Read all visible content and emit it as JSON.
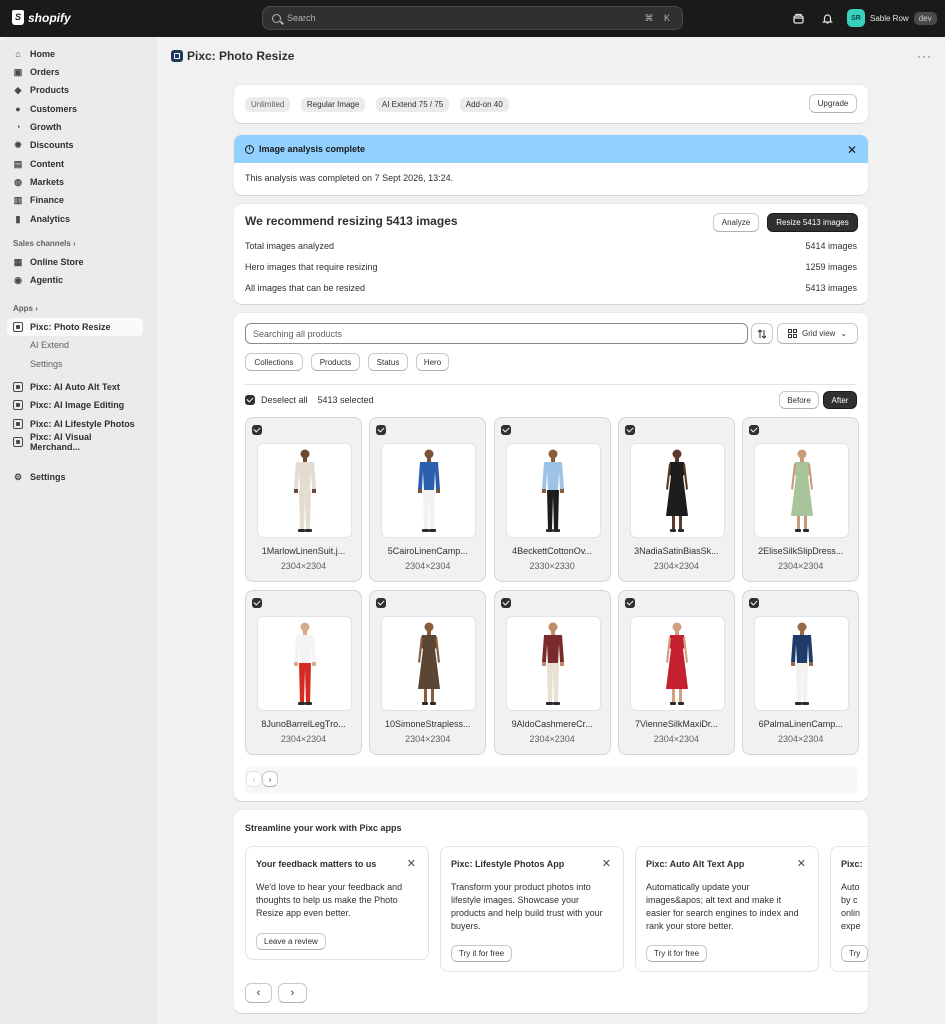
{
  "topbar": {
    "brand": "shopify",
    "search_placeholder": "Search",
    "shortcut_keys": [
      "⌘",
      "K"
    ],
    "user_initials": "SR",
    "user_name": "Sable Row",
    "env_badge": "dev"
  },
  "sidebar": {
    "main_items": [
      {
        "label": "Home",
        "icon": "home-icon"
      },
      {
        "label": "Orders",
        "icon": "orders-icon"
      },
      {
        "label": "Products",
        "icon": "tag-icon"
      },
      {
        "label": "Customers",
        "icon": "person-icon"
      },
      {
        "label": "Growth",
        "icon": "growth-icon"
      },
      {
        "label": "Discounts",
        "icon": "discount-icon"
      },
      {
        "label": "Content",
        "icon": "content-icon"
      },
      {
        "label": "Markets",
        "icon": "globe-icon"
      },
      {
        "label": "Finance",
        "icon": "bank-icon"
      },
      {
        "label": "Analytics",
        "icon": "bar-chart-icon"
      }
    ],
    "sales_channels_heading": "Sales channels",
    "sales_channels": [
      {
        "label": "Online Store"
      },
      {
        "label": "Agentic"
      }
    ],
    "apps_heading": "Apps",
    "active_app": "Pixc: Photo Resize",
    "active_app_sub": [
      "AI Extend",
      "Settings"
    ],
    "other_apps": [
      "Pixc: AI Auto Alt Text",
      "Pixc: AI Image Editing",
      "Pixc: AI Lifestyle Photos",
      "Pixc: AI Visual Merchand..."
    ],
    "settings_label": "Settings"
  },
  "page": {
    "title": "Pixc: Photo Resize"
  },
  "plan": {
    "pills": [
      "Unlimited",
      "Regular Image",
      "AI Extend 75 / 75",
      "Add-on 40"
    ],
    "upgrade_label": "Upgrade"
  },
  "banner": {
    "title": "Image analysis complete",
    "body": "This analysis was completed on 7 Sept 2026, 13:24."
  },
  "recommend": {
    "heading": "We recommend resizing 5413 images",
    "analyze_label": "Analyze",
    "resize_label": "Resize 5413 images",
    "rows": [
      {
        "label": "Total images analyzed",
        "value": "5414 images"
      },
      {
        "label": "Hero images that require resizing",
        "value": "1259 images"
      },
      {
        "label": "All images that can be resized",
        "value": "5413 images"
      }
    ]
  },
  "gallery": {
    "search_placeholder": "Searching all products",
    "view_label": "Grid view",
    "filters": [
      "Collections",
      "Products",
      "Status",
      "Hero"
    ],
    "deselect_label": "Deselect all",
    "selected_count": "5413 selected",
    "before_label": "Before",
    "after_label": "After",
    "items": [
      {
        "name": "1MarlowLinenSuit.j...",
        "dim": "2304×2304",
        "top": "#e2ddd0",
        "bottom": "#e2ddd0",
        "skin": "#6b4a35",
        "dress": false
      },
      {
        "name": "5CairoLinenCamp...",
        "dim": "2304×2304",
        "top": "#2a5fb0",
        "bottom": "#f2f2f2",
        "skin": "#7a5238",
        "dress": false
      },
      {
        "name": "4BeckettCottonOv...",
        "dim": "2330×2330",
        "top": "#9cc2e6",
        "bottom": "#1c1c1c",
        "skin": "#8a5a3a",
        "dress": false
      },
      {
        "name": "3NadiaSatinBiasSk...",
        "dim": "2304×2304",
        "top": "#1c1c1c",
        "bottom": "#1f8a55",
        "skin": "#5a3a28",
        "dress": true
      },
      {
        "name": "2EliseSilkSlipDress...",
        "dim": "2304×2304",
        "top": "#a9c49a",
        "bottom": "#a9c49a",
        "skin": "#c99b7a",
        "dress": true
      },
      {
        "name": "8JunoBarrelLegTro...",
        "dim": "2304×2304",
        "top": "#f4f4f4",
        "bottom": "#d42a22",
        "skin": "#d8ab8c",
        "dress": false
      },
      {
        "name": "10SimoneStrapless...",
        "dim": "2304×2304",
        "top": "#5a4632",
        "bottom": "#5a4632",
        "skin": "#8a5a3a",
        "dress": true
      },
      {
        "name": "9AldoCashmereCr...",
        "dim": "2304×2304",
        "top": "#7a2a2a",
        "bottom": "#e8e0d0",
        "skin": "#c08a6a",
        "dress": false
      },
      {
        "name": "7VienneSilkMaxiDr...",
        "dim": "2304×2304",
        "top": "#c42030",
        "bottom": "#c42030",
        "skin": "#d0a080",
        "dress": true
      },
      {
        "name": "6PalmaLinenCamp...",
        "dim": "2304×2304",
        "top": "#1f3b6b",
        "bottom": "#f2f2f2",
        "skin": "#9a6a48",
        "dress": false
      }
    ]
  },
  "streamline": {
    "heading": "Streamline your work with Pixc apps",
    "cards": [
      {
        "title": "Your feedback matters to us",
        "body": "We'd love to hear your feedback and thoughts to help us make the Photo Resize app even better.",
        "button": "Leave a review"
      },
      {
        "title": "Pixc: Lifestyle Photos App",
        "body": "Transform your product photos into lifestyle images. Showcase your products and help build trust with your buyers.",
        "button": "Try it for free"
      },
      {
        "title": "Pixc: Auto Alt Text App",
        "body": "Automatically update your images&apos; alt text and make it easier for search engines to index and rank your store better.",
        "button": "Try it for free"
      },
      {
        "title": "Pixc:",
        "body": "Auto by c onlin expe",
        "button": "Try"
      }
    ]
  }
}
